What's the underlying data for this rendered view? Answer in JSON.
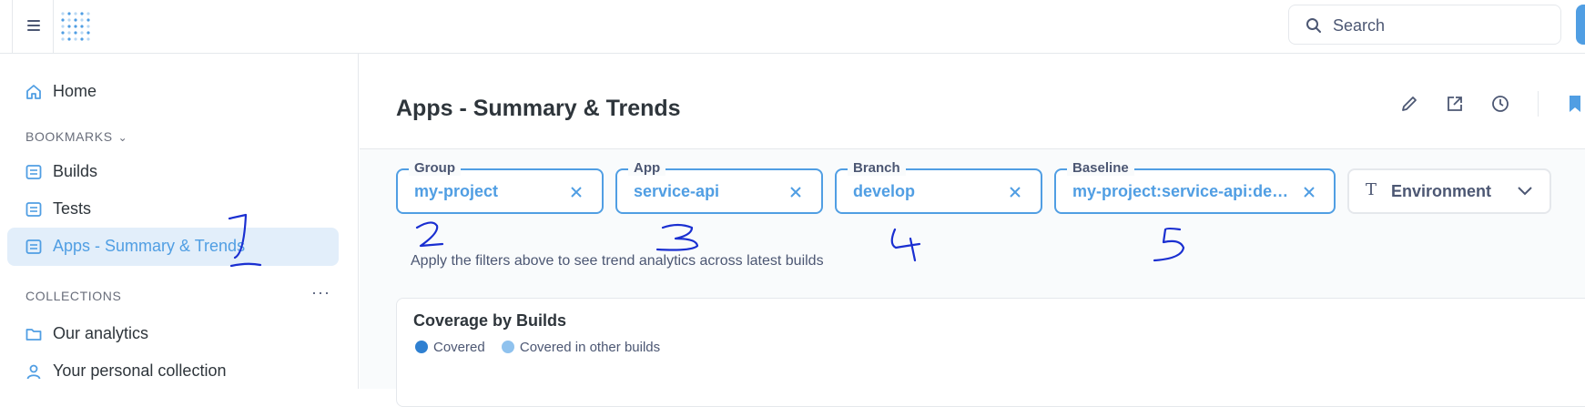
{
  "colors": {
    "accent": "#509ee3",
    "covered": "#2f80d1",
    "covered_other": "#8fc2ee",
    "annotation": "#1a2fd1"
  },
  "header": {
    "search_placeholder": "Search"
  },
  "sidebar": {
    "home": "Home",
    "bookmarks_heading": "BOOKMARKS",
    "bookmarks": [
      "Builds",
      "Tests",
      "Apps - Summary & Trends"
    ],
    "collections_heading": "COLLECTIONS",
    "collections": [
      "Our analytics",
      "Your personal collection"
    ]
  },
  "page": {
    "title": "Apps - Summary & Trends"
  },
  "filters": [
    {
      "label": "Group",
      "value": "my-project"
    },
    {
      "label": "App",
      "value": "service-api"
    },
    {
      "label": "Branch",
      "value": "develop"
    },
    {
      "label": "Baseline",
      "value": "my-project:service-api:devel…"
    }
  ],
  "environment_filter": {
    "label": "Environment"
  },
  "hint": "Apply the filters above to see trend analytics across latest builds",
  "card": {
    "title": "Coverage by Builds",
    "legend": [
      "Covered",
      "Covered in other builds"
    ]
  },
  "annotations": [
    "1",
    "2",
    "3",
    "4",
    "5"
  ]
}
